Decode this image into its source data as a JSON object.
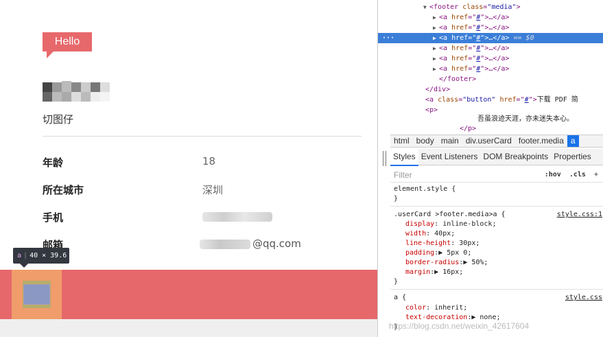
{
  "page": {
    "hello_badge": "Hello",
    "username": "切图仔",
    "rows": [
      {
        "label": "年龄",
        "value": "18"
      },
      {
        "label": "所在城市",
        "value": "深圳"
      },
      {
        "label": "手机",
        "value": ""
      },
      {
        "label": "邮箱",
        "value": "@qq.com"
      }
    ],
    "tooltip": {
      "tag": "a",
      "size": "40 × 39.6"
    },
    "colors": {
      "accent": "#e7686b",
      "footer": "#e6686b",
      "margin_highlight": "#f09d6b",
      "content_highlight": "#8b98c4"
    }
  },
  "devtools": {
    "dom": {
      "footer_open_tag": "footer",
      "footer_class_attr": "class",
      "footer_class_value": "\"media\"",
      "anchor_tag": "a",
      "href_attr": "href",
      "href_value": "#",
      "ellipsis": "…",
      "selected_suffix": "== $0",
      "footer_close": "</footer>",
      "div_close": "</div>",
      "button_class_value": "\"button\"",
      "button_text": "下载 PDF 简",
      "p_open": "<p>",
      "p_text": "吾虽浪迹天涯，亦未迷失本心。",
      "p_close": "</p>"
    },
    "breadcrumb": [
      "html",
      "body",
      "main",
      "div.userCard",
      "footer.media",
      "a"
    ],
    "tabs": [
      "Styles",
      "Event Listeners",
      "DOM Breakpoints",
      "Properties"
    ],
    "filter": {
      "placeholder": "Filter",
      "hov": ":hov",
      "cls": ".cls",
      "plus": "+"
    },
    "styles": {
      "element_style": "element.style {",
      "close_brace": "}",
      "rule1_selector": ".userCard >footer.media>a {",
      "rule1_source": "style.css:1",
      "rule1_props": [
        {
          "name": "display",
          "value": "inline-block;"
        },
        {
          "name": "width",
          "value": "40px;"
        },
        {
          "name": "line-height",
          "value": "30px;"
        },
        {
          "name": "padding",
          "value": "▶ 5px 0;"
        },
        {
          "name": "border-radius",
          "value": "▶ 50%;"
        },
        {
          "name": "margin",
          "value": "▶ 16px;"
        }
      ],
      "rule2_selector": "a {",
      "rule2_source": "style.css",
      "rule2_props": [
        {
          "name": "color",
          "value": "inherit;"
        },
        {
          "name": "text-decoration",
          "value": "▶ none;"
        }
      ]
    },
    "watermark": "https://blog.csdn.net/weixin_42617604"
  }
}
